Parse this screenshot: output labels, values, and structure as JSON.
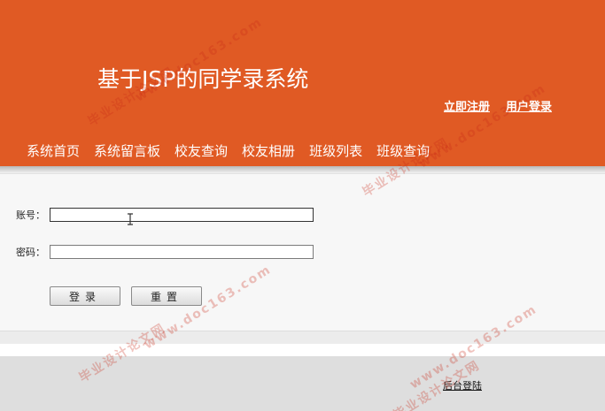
{
  "header": {
    "title": "基于JSP的同学录系统",
    "top_links": [
      "立即注册",
      "用户登录"
    ],
    "nav": [
      "系统首页",
      "系统留言板",
      "校友查询",
      "校友相册",
      "班级列表",
      "班级查询"
    ]
  },
  "login": {
    "account_label": "账号：",
    "account_value": "",
    "password_label": "密码：",
    "password_value": "",
    "submit_label": "登录",
    "reset_label": "重置"
  },
  "footer": {
    "admin_link": "后台登陆"
  },
  "watermark": {
    "site_text": "毕业设计论文网",
    "url_text": "www.doc163.com"
  },
  "colors": {
    "header_bg": "#e05a24",
    "watermark": "#c82814"
  }
}
